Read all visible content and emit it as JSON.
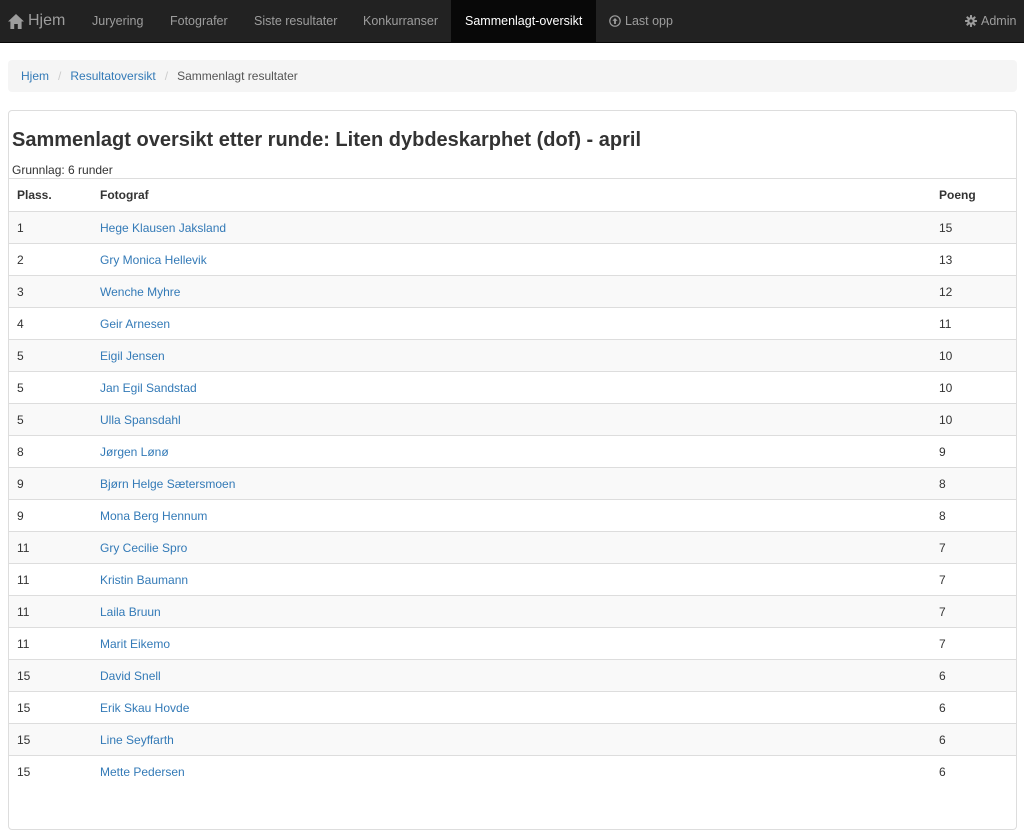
{
  "navbar": {
    "brand": "Hjem",
    "items": [
      "Juryering",
      "Fotografer",
      "Siste resultater",
      "Konkurranser",
      "Sammenlagt-oversikt",
      "Last opp"
    ],
    "admin": "Admin"
  },
  "breadcrumb": {
    "home": "Hjem",
    "overview": "Resultatoversikt",
    "current": "Sammenlagt resultater"
  },
  "heading": "Sammenlagt oversikt etter runde: Liten dybdeskarphet (dof) - april",
  "basis": "Grunnlag: 6 runder",
  "table": {
    "headers": [
      "Plass.",
      "Fotograf",
      "Poeng"
    ],
    "rows": [
      {
        "place": "1",
        "name": "Hege Klausen Jaksland",
        "points": "15"
      },
      {
        "place": "2",
        "name": "Gry Monica Hellevik",
        "points": "13"
      },
      {
        "place": "3",
        "name": "Wenche Myhre",
        "points": "12"
      },
      {
        "place": "4",
        "name": "Geir Arnesen",
        "points": "11"
      },
      {
        "place": "5",
        "name": "Eigil Jensen",
        "points": "10"
      },
      {
        "place": "5",
        "name": "Jan Egil Sandstad",
        "points": "10"
      },
      {
        "place": "5",
        "name": "Ulla Spansdahl",
        "points": "10"
      },
      {
        "place": "8",
        "name": "Jørgen Lønø",
        "points": "9"
      },
      {
        "place": "9",
        "name": "Bjørn Helge Sætersmoen",
        "points": "8"
      },
      {
        "place": "9",
        "name": "Mona Berg Hennum",
        "points": "8"
      },
      {
        "place": "11",
        "name": "Gry Cecilie Spro",
        "points": "7"
      },
      {
        "place": "11",
        "name": "Kristin Baumann",
        "points": "7"
      },
      {
        "place": "11",
        "name": "Laila Bruun",
        "points": "7"
      },
      {
        "place": "11",
        "name": "Marit Eikemo",
        "points": "7"
      },
      {
        "place": "15",
        "name": "David Snell",
        "points": "6"
      },
      {
        "place": "15",
        "name": "Erik Skau Hovde",
        "points": "6"
      },
      {
        "place": "15",
        "name": "Line Seyffarth",
        "points": "6"
      },
      {
        "place": "15",
        "name": "Mette Pedersen",
        "points": "6"
      }
    ]
  },
  "colors": {
    "navbar_bg": "#222222",
    "link": "#337ab7",
    "active_tab_bg": "#080808"
  },
  "icons": {
    "brand": "home-icon",
    "upload": "upload-icon",
    "admin": "gear-icon"
  }
}
